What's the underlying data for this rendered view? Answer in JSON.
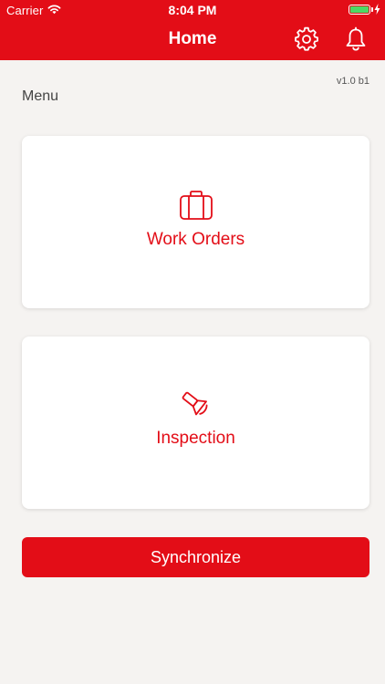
{
  "status_bar": {
    "carrier": "Carrier",
    "time": "8:04 PM",
    "battery_level": 1.0,
    "battery_color": "#4cd964"
  },
  "header": {
    "title": "Home",
    "background_color": "#e30d17",
    "settings_icon": "gear-icon",
    "notifications_icon": "bell-icon"
  },
  "version": "v1.0 b1",
  "menu": {
    "label": "Menu",
    "items": [
      {
        "label": "Work Orders",
        "icon": "briefcase-icon"
      },
      {
        "label": "Inspection",
        "icon": "flashlight-icon"
      }
    ]
  },
  "sync_button": {
    "label": "Synchronize"
  }
}
